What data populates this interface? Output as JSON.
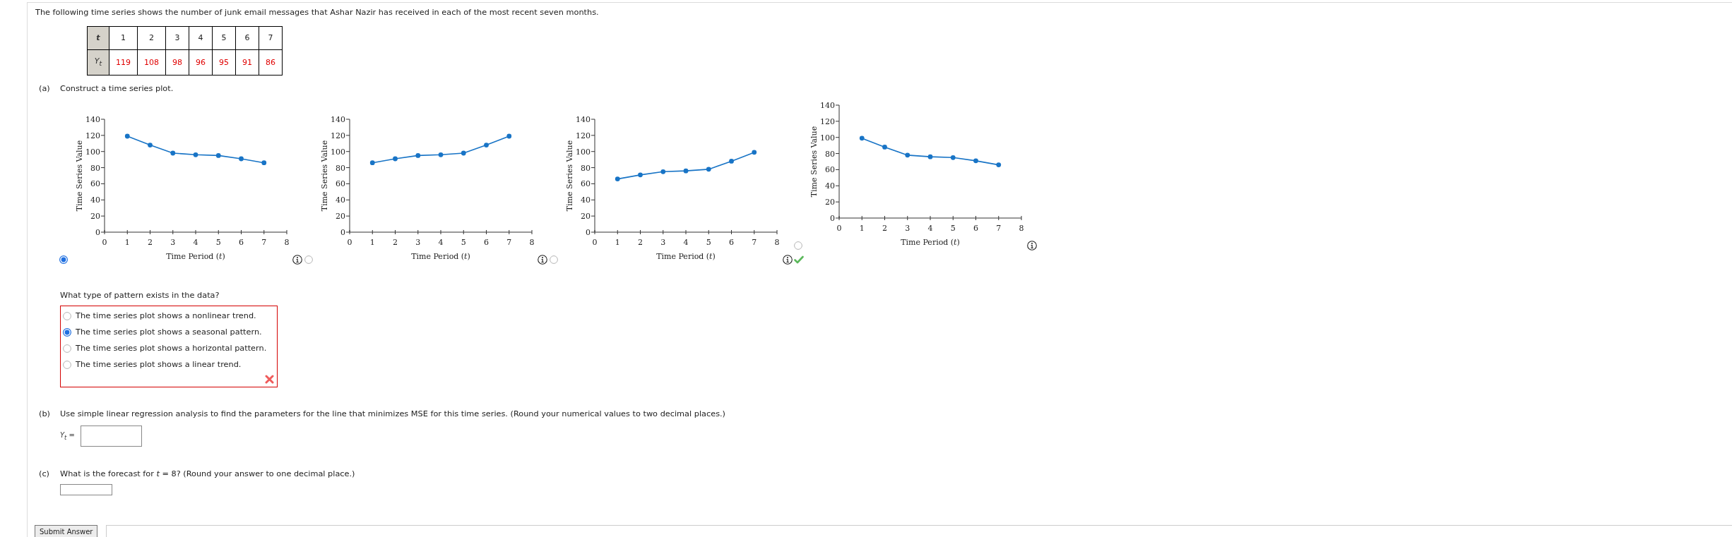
{
  "intro": "The following time series shows the number of junk email messages that Ashar Nazir has received in each of the most recent seven months.",
  "data_table": {
    "rows": [
      {
        "kind": "index",
        "header": "t",
        "cells": [
          "1",
          "2",
          "3",
          "4",
          "5",
          "6",
          "7"
        ]
      },
      {
        "kind": "value",
        "header": "Y$_{t}$",
        "cells": [
          "119",
          "108",
          "98",
          "96",
          "95",
          "91",
          "86"
        ]
      }
    ]
  },
  "part_a": {
    "label": "(a)",
    "prompt": "Construct a time series plot.",
    "plot_choices": [
      {
        "selected": true,
        "marked_correct": false,
        "chart_data": {
          "type": "line",
          "xlabel": "Time Period (*t*)",
          "ylabel": "Time Series Value",
          "x": [
            1,
            2,
            3,
            4,
            5,
            6,
            7
          ],
          "series": [
            {
              "color": "#1874c6",
              "marker": "circle",
              "values": [
                119,
                108,
                98,
                96,
                95,
                91,
                86
              ]
            }
          ],
          "xlim": [
            0,
            8
          ],
          "ylim": [
            0,
            140
          ],
          "xticks": [
            0,
            1,
            2,
            3,
            4,
            5,
            6,
            7,
            8
          ],
          "yticks": [
            0,
            20,
            40,
            60,
            80,
            100,
            120,
            140
          ]
        }
      },
      {
        "selected": false,
        "marked_correct": false,
        "chart_data": {
          "type": "line",
          "xlabel": "Time Period (*t*)",
          "ylabel": "Time Series Value",
          "x": [
            1,
            2,
            3,
            4,
            5,
            6,
            7
          ],
          "series": [
            {
              "color": "#1874c6",
              "marker": "circle",
              "values": [
                86,
                91,
                95,
                96,
                98,
                108,
                119
              ]
            }
          ],
          "xlim": [
            0,
            8
          ],
          "ylim": [
            0,
            140
          ],
          "xticks": [
            0,
            1,
            2,
            3,
            4,
            5,
            6,
            7,
            8
          ],
          "yticks": [
            0,
            20,
            40,
            60,
            80,
            100,
            120,
            140
          ]
        }
      },
      {
        "selected": false,
        "marked_correct": true,
        "chart_data": {
          "type": "line",
          "xlabel": "Time Period (*t*)",
          "ylabel": "Time Series Value",
          "x": [
            1,
            2,
            3,
            4,
            5,
            6,
            7
          ],
          "series": [
            {
              "color": "#1874c6",
              "marker": "circle",
              "values": [
                66,
                71,
                75,
                76,
                78,
                88,
                99
              ]
            }
          ],
          "xlim": [
            0,
            8
          ],
          "ylim": [
            0,
            140
          ],
          "xticks": [
            0,
            1,
            2,
            3,
            4,
            5,
            6,
            7,
            8
          ],
          "yticks": [
            0,
            20,
            40,
            60,
            80,
            100,
            120,
            140
          ]
        }
      },
      {
        "selected": false,
        "marked_correct": false,
        "chart_data": {
          "type": "line",
          "xlabel": "Time Period (*t*)",
          "ylabel": "Time Series Value",
          "x": [
            1,
            2,
            3,
            4,
            5,
            6,
            7
          ],
          "series": [
            {
              "color": "#1874c6",
              "marker": "circle",
              "values": [
                99,
                88,
                78,
                76,
                75,
                71,
                66
              ]
            }
          ],
          "xlim": [
            0,
            8
          ],
          "ylim": [
            0,
            140
          ],
          "xticks": [
            0,
            1,
            2,
            3,
            4,
            5,
            6,
            7,
            8
          ],
          "yticks": [
            0,
            20,
            40,
            60,
            80,
            100,
            120,
            140
          ]
        }
      }
    ],
    "pattern_question": {
      "prompt": "What type of pattern exists in the data?",
      "answered_correctly": false,
      "options": [
        {
          "label": "The time series plot shows a nonlinear trend.",
          "selected": false
        },
        {
          "label": "The time series plot shows a seasonal pattern.",
          "selected": true
        },
        {
          "label": "The time series plot shows a horizontal pattern.",
          "selected": false
        },
        {
          "label": "The time series plot shows a linear trend.",
          "selected": false
        }
      ]
    }
  },
  "part_b": {
    "label": "(b)",
    "prompt": "Use simple linear regression analysis to find the parameters for the line that minimizes MSE for this time series. (Round your numerical values to two decimal places.)",
    "answer_label": "*Y*$_{t}$ ="
  },
  "part_c": {
    "label": "(c)",
    "prompt": "What is the forecast for *t* = 8? (Round your answer to one decimal place.)"
  },
  "submit_button": "Submit Answer"
}
